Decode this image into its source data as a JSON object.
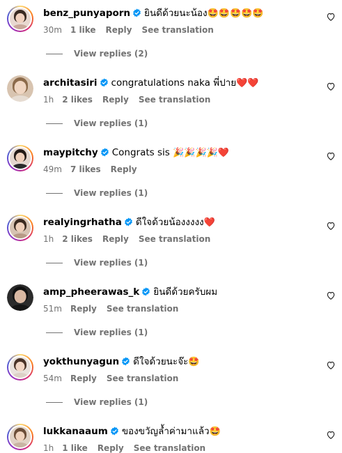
{
  "comments": [
    {
      "username": "benz_punyaporn",
      "text": "ยินดีด้วยนะน้อง",
      "emojis": "🤩🤩🤩🤩🤩",
      "time": "30m",
      "likes": "1 like",
      "reply": "Reply",
      "translate": "See translation",
      "replies": "View replies (2)",
      "ring": true
    },
    {
      "username": "architasiri",
      "text": "congratulations naka พี่ปาย",
      "emojis": "❤️❤️",
      "time": "1h",
      "likes": "2 likes",
      "reply": "Reply",
      "translate": "See translation",
      "replies": "View replies (1)",
      "ring": false
    },
    {
      "username": "maypitchy",
      "text": "Congrats sis",
      "emojis": "🎉🎉🎉🎉❤️",
      "time": "49m",
      "likes": "7 likes",
      "reply": "Reply",
      "translate": "",
      "replies": "View replies (1)",
      "ring": true
    },
    {
      "username": "realyingrhatha",
      "text": "ดีใจด้วยน้องงงงง",
      "emojis": "❤️",
      "time": "1h",
      "likes": "2 likes",
      "reply": "Reply",
      "translate": "See translation",
      "replies": "View replies (1)",
      "ring": true
    },
    {
      "username": "amp_pheerawas_k",
      "text": "ยินดีด้วยครับผม",
      "emojis": "",
      "time": "51m",
      "likes": "",
      "reply": "Reply",
      "translate": "See translation",
      "replies": "View replies (1)",
      "ring": false
    },
    {
      "username": "yokthunyagun",
      "text": "ดีใจด้วยนะจ๊ะ",
      "emojis": "🤩",
      "time": "54m",
      "likes": "",
      "reply": "Reply",
      "translate": "See translation",
      "replies": "View replies (1)",
      "ring": true
    },
    {
      "username": "lukkanaaum",
      "text": "ของขวัญล้ำค่ามาแล้ว",
      "emojis": "🤩",
      "time": "1h",
      "likes": "1 like",
      "reply": "Reply",
      "translate": "See translation",
      "replies": "",
      "ring": true
    }
  ],
  "colors": {
    "meta": "#737373",
    "verified": "#0095f6",
    "text": "#000000"
  },
  "icons": {
    "verified": "verified-badge-icon",
    "like": "heart-outline-icon"
  }
}
